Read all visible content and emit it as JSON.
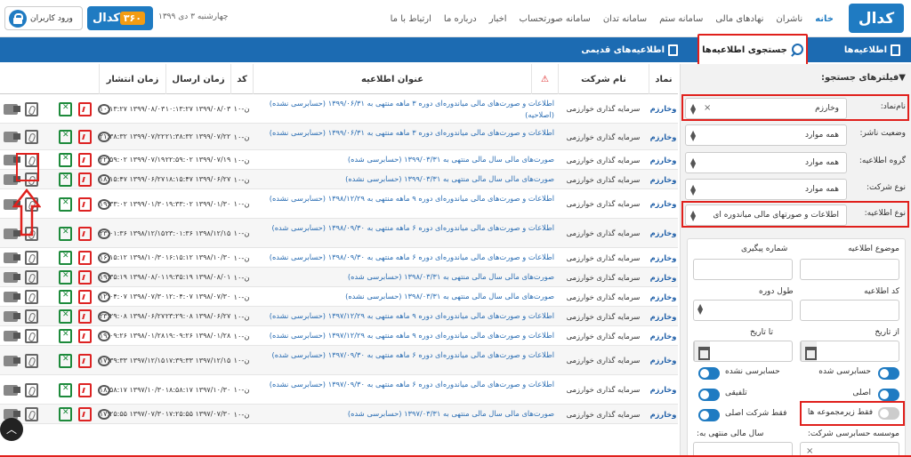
{
  "header": {
    "logo": "کدال",
    "nav": [
      "خانه",
      "ناشران",
      "نهادهای مالی",
      "سامانه ستم",
      "سامانه تدان",
      "سامانه صورتحساب",
      "اخبار",
      "درباره ما",
      "ارتباط با ما"
    ],
    "date": "چهارشنبه ۳ دی ۱۳۹۹",
    "badge_text": "کدال",
    "badge_num": "۳۶۰",
    "login": "ورود کاربران"
  },
  "bar": {
    "announcements": "اطلاعیه‌ها",
    "search": "جستجوی اطلاعیه‌ها",
    "old": "اطلاعیه‌های قدیمی"
  },
  "filters": {
    "title": "فیلترهای جستجو:",
    "symbol_label": "نام‌نماد:",
    "symbol_value": "وخارزم",
    "status_label": "وضعیت ناشر:",
    "status_value": "همه موارد",
    "group_label": "گروه اطلاعیه:",
    "group_value": "همه موارد",
    "company_label": "نوع شرکت:",
    "company_value": "همه موارد",
    "type_label": "نوع اطلاعیه:",
    "type_value": "اطلاعات و صورتهای مالی میاندوره ای",
    "subject_label": "موضوع اطلاعیه",
    "tracking_label": "شماره پیگیری",
    "code_label": "کد اطلاعیه",
    "period_label": "طول دوره",
    "from_label": "از تاریخ",
    "to_label": "تا تاریخ",
    "audited": "حسابرسی شده",
    "unaudited": "حسابرسی نشده",
    "original": "اصلی",
    "merged": "تلفیقی",
    "subsidiary": "فقط زیرمجموعه ها",
    "main_company": "فقط شرکت اصلی",
    "audit_firm": "موسسه حسابرسی شرکت:",
    "fiscal_year": "سال مالی منتهی به:"
  },
  "table": {
    "headers": {
      "symbol": "نماد",
      "company": "نام شرکت",
      "title": "عنوان اطلاعیه",
      "code": "کد",
      "send": "زمان ارسال",
      "publish": "زمان انتشار"
    },
    "rows": [
      {
        "symbol": "وخارزم",
        "company": "سرمایه گذاری خوارزمی",
        "title": "اطلاعات و صورت‌های مالی میاندوره‌ای دوره ۳ ماهه منتهی به ۱۳۹۹/۰۶/۳۱ (حسابرسی نشده)(اصلاحیه)",
        "code": "ن-۱۰",
        "send": "۱۳۹۹/۰۸/۰۳ ۱۰:۱۳:۲۷",
        "publish": "۱۳۹۹/۰۸/۰۳ ۱۰:۱۳:۲۷"
      },
      {
        "symbol": "وخارزم",
        "company": "سرمایه گذاری خوارزمی",
        "title": "اطلاعات و صورت‌های مالی میاندوره‌ای دوره ۳ ماهه منتهی به ۱۳۹۹/۰۶/۳۱ (حسابرسی نشده)",
        "code": "ن-۱۰",
        "send": "۱۳۹۹/۰۷/۲۲ ۲۱:۳۸:۳۲",
        "publish": "۱۳۹۹/۰۷/۲۲ ۲۱:۳۸:۳۲"
      },
      {
        "symbol": "وخارزم",
        "company": "سرمایه گذاری خوارزمی",
        "title": "صورت‌های مالی سال مالی منتهی به ۱۳۹۹/۰۳/۳۱ (حسابرسی شده)",
        "code": "ن-۱۰",
        "send": "۱۳۹۹/۰۷/۱۹ ۲۲:۵۹:۰۲",
        "publish": "۱۳۹۹/۰۷/۱۹ ۲۲:۵۹:۰۲"
      },
      {
        "symbol": "وخارزم",
        "company": "سرمایه گذاری خوارزمی",
        "title": "صورت‌های مالی سال مالی منتهی به ۱۳۹۹/۰۳/۳۱ (حسابرسی نشده)",
        "code": "ن-۱۰",
        "send": "۱۳۹۹/۰۶/۲۷ ۱۸:۱۵:۴۷",
        "publish": "۱۳۹۹/۰۶/۲۷ ۱۸:۱۵:۴۷"
      },
      {
        "symbol": "وخارزم",
        "company": "سرمایه گذاری خوارزمی",
        "title": "اطلاعات و صورت‌های مالی میاندوره‌ای دوره ۹ ماهه منتهی به ۱۳۹۸/۱۲/۲۹ (حسابرسی نشده)",
        "code": "ن-۱۰",
        "send": "۱۳۹۹/۰۱/۳۰ ۱۹:۳۳:۰۲",
        "publish": "۱۳۹۹/۰۱/۳۰ ۱۹:۳۳:۰۲"
      },
      {
        "symbol": "وخارزم",
        "company": "سرمایه گذاری خوارزمی",
        "title": "اطلاعات و صورت‌های مالی میاندوره‌ای دوره ۶ ماهه منتهی به ۱۳۹۸/۰۹/۳۰ (حسابرسی شده)",
        "code": "ن-۱۰",
        "send": "۱۳۹۸/۱۲/۱۵ ۲۳:۰۱:۳۶",
        "publish": "۱۳۹۸/۱۲/۱۵ ۲۳:۰۱:۳۶"
      },
      {
        "symbol": "وخارزم",
        "company": "سرمایه گذاری خوارزمی",
        "title": "اطلاعات و صورت‌های مالی میاندوره‌ای دوره ۶ ماهه منتهی به ۱۳۹۸/۰۹/۳۰ (حسابرسی نشده)",
        "code": "ن-۱۰",
        "send": "۱۳۹۸/۱۰/۳۰ ۱۶:۱۵:۱۲",
        "publish": "۱۳۹۸/۱۰/۳۰ ۱۶:۱۵:۱۲"
      },
      {
        "symbol": "وخارزم",
        "company": "سرمایه گذاری خوارزمی",
        "title": "صورت‌های مالی سال مالی منتهی به ۱۳۹۸/۰۳/۳۱ (حسابرسی شده)",
        "code": "ن-۱۰",
        "send": "۱۳۹۸/۰۸/۰۱ ۱۹:۳۵:۱۹",
        "publish": "۱۳۹۸/۰۸/۰۱ ۱۹:۳۵:۱۹"
      },
      {
        "symbol": "وخارزم",
        "company": "سرمایه گذاری خوارزمی",
        "title": "صورت‌های مالی سال مالی منتهی به ۱۳۹۸/۰۳/۳۱ (حسابرسی نشده)",
        "code": "ن-۱۰",
        "send": "۱۳۹۸/۰۷/۳۰ ۱۲:۰۴:۰۷",
        "publish": "۱۳۹۸/۰۷/۳۰ ۱۲:۰۴:۰۷"
      },
      {
        "symbol": "وخارزم",
        "company": "سرمایه گذاری خوارزمی",
        "title": "اطلاعات و صورت‌های مالی میاندوره‌ای دوره ۹ ماهه منتهی به ۱۳۹۷/۱۲/۲۹ (حسابرسی نشده)",
        "code": "ن-۱۰",
        "send": "۱۳۹۸/۰۶/۲۷ ۲۳:۲۹:۰۸",
        "publish": "۱۳۹۸/۰۶/۲۷ ۲۳:۲۹:۰۸"
      },
      {
        "symbol": "وخارزم",
        "company": "سرمایه گذاری خوارزمی",
        "title": "اطلاعات و صورت‌های مالی میاندوره‌ای دوره ۹ ماهه منتهی به ۱۳۹۷/۱۲/۲۹ (حسابرسی نشده)",
        "code": "ن-۱۰",
        "send": "۱۳۹۸/۰۱/۲۸ ۱۹:۰۹:۲۶",
        "publish": "۱۳۹۸/۰۱/۲۸ ۱۹:۰۹:۲۶"
      },
      {
        "symbol": "وخارزم",
        "company": "سرمایه گذاری خوارزمی",
        "title": "اطلاعات و صورت‌های مالی میاندوره‌ای دوره ۶ ماهه منتهی به ۱۳۹۷/۰۹/۳۰ (حسابرسی شده)",
        "code": "ن-۱۰",
        "send": "۱۳۹۷/۱۲/۱۵ ۱۷:۳۹:۳۳",
        "publish": "۱۳۹۷/۱۲/۱۵ ۱۷:۳۹:۳۳"
      },
      {
        "symbol": "وخارزم",
        "company": "سرمایه گذاری خوارزمی",
        "title": "اطلاعات و صورت‌های مالی میاندوره‌ای دوره ۶ ماهه منتهی به ۱۳۹۷/۰۹/۳۰ (حسابرسی نشده)",
        "code": "ن-۱۰",
        "send": "۱۳۹۷/۱۰/۳۰ ۱۸:۵۸:۱۷",
        "publish": "۱۳۹۷/۱۰/۳۰ ۱۸:۵۸:۱۷"
      },
      {
        "symbol": "وخارزم",
        "company": "سرمایه گذاری خوارزمی",
        "title": "صورت‌های مالی سال مالی منتهی به ۱۳۹۷/۰۳/۳۱ (حسابرسی شده)",
        "code": "ن-۱۰",
        "send": "۱۳۹۷/۰۷/۳۰ ۱۷:۲۵:۵۵",
        "publish": "۱۳۹۷/۰۷/۳۰ ۱۷:۲۵:۵۵"
      }
    ]
  }
}
